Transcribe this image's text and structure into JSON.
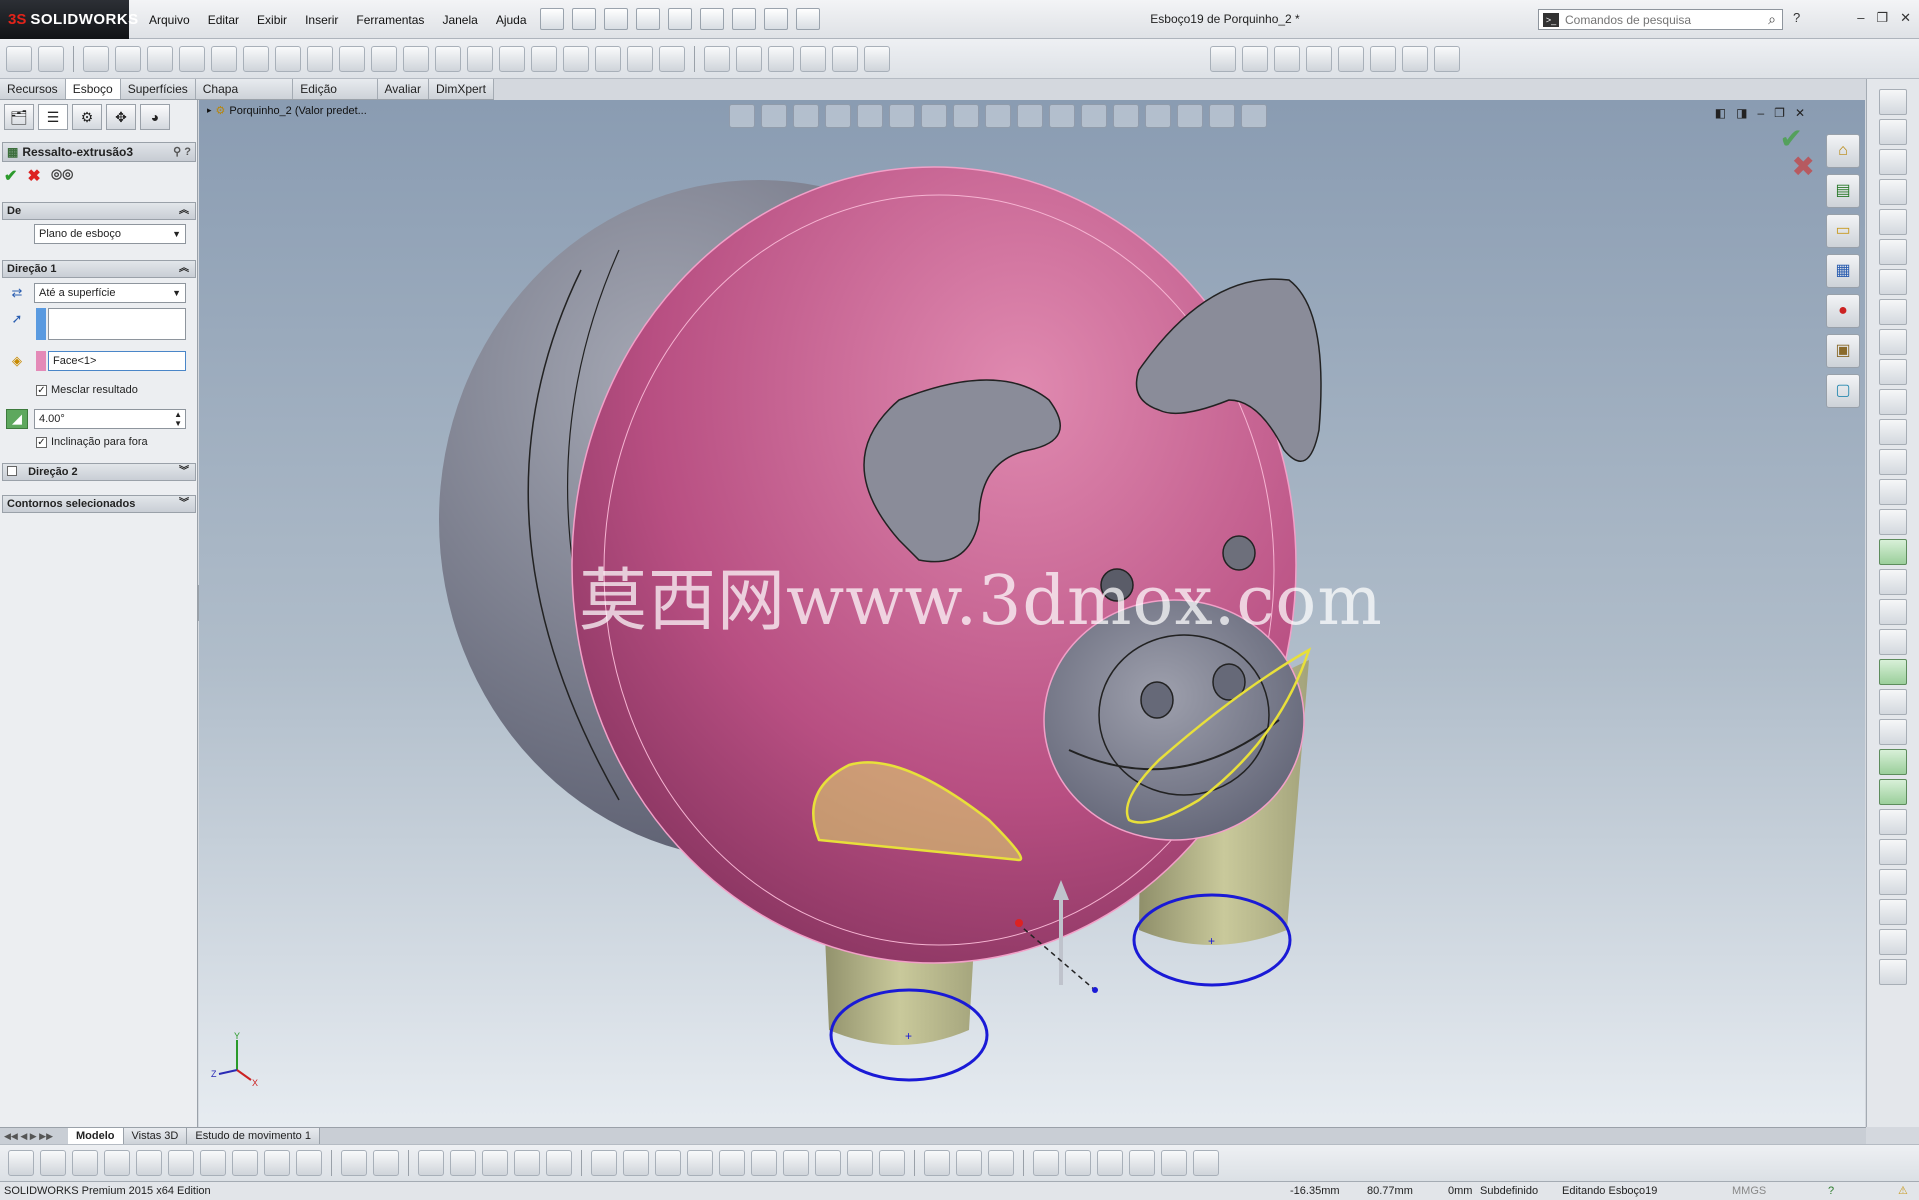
{
  "app": {
    "logo_mark": "3S",
    "logo_text": "SOLIDWORKS",
    "document_title": "Esboço19 de Porquinho_2 *",
    "menu": [
      "Arquivo",
      "Editar",
      "Exibir",
      "Inserir",
      "Ferramentas",
      "Janela",
      "Ajuda"
    ],
    "search_placeholder": "Comandos de pesquisa"
  },
  "ribbon_tabs": [
    "Recursos",
    "Esboço",
    "Superfícies",
    "Chapa metálica",
    "Edição direta",
    "Avaliar",
    "DimXpert"
  ],
  "active_ribbon_tab": "Esboço",
  "property_manager": {
    "feature_title": "Ressalto-extrusão3",
    "from_section": {
      "title": "De",
      "start_condition": "Plano de esboço"
    },
    "direction1": {
      "title": "Direção 1",
      "end_condition": "Até a superfície",
      "direction_value": "",
      "face_selection": "Face<1>",
      "merge_result_label": "Mesclar resultado",
      "merge_result_checked": true,
      "draft_angle": "4.00°",
      "draft_outward_label": "Inclinação para fora",
      "draft_outward_checked": true
    },
    "direction2_title": "Direção 2",
    "direction2_checked": false,
    "selected_contours_title": "Contornos selecionados"
  },
  "feature_tree_flyout": "Porquinho_2  (Valor predet...",
  "watermark": "莫西网www.3dmox.com",
  "triad_labels": {
    "y": "Y",
    "z": "Z",
    "x": "X"
  },
  "bottom_tabs": [
    "Modelo",
    "Vistas 3D",
    "Estudo de movimento 1"
  ],
  "active_bottom_tab": "Modelo",
  "status_bar": {
    "edition": "SOLIDWORKS Premium 2015 x64 Edition",
    "x_coord": "-16.35mm",
    "y_coord": "80.77mm",
    "z_coord": "0mm",
    "definition": "Subdefinido",
    "mode": "Editando Esboço19",
    "units": "MMGS"
  },
  "colors": {
    "selected_face": "#c0578a",
    "sketch_contour": "#1a1ad6",
    "highlight_contour": "#e8e03a",
    "body_gray": "#7a7d8a",
    "extrusion_preview": "#b9b98a",
    "viewport_top": "#8a9cb2",
    "viewport_bottom": "#e7ecf1"
  }
}
